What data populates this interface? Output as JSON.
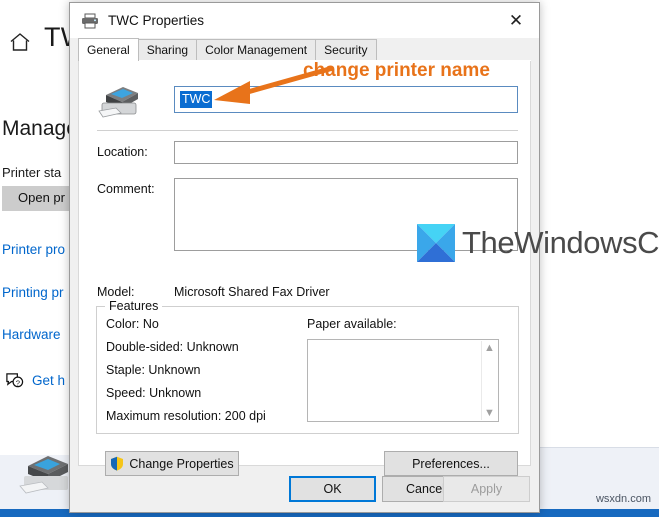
{
  "background": {
    "home_icon": "home-icon",
    "device_title": "TW",
    "manage_heading": "Manage",
    "printer_status_label": "Printer sta",
    "open_queue_button": "Open pr",
    "links": [
      "Printer pro",
      "Printing pr",
      "Hardware"
    ],
    "get_help_label": "Get h",
    "get_help_icon": "help-chat-icon",
    "printer_image": "printer-illustration-icon"
  },
  "watermarks": {
    "brand": "TheWindowsClub",
    "brand_logo": "thewindowsclub-logo-icon",
    "site": "wsxdn.com"
  },
  "dialog": {
    "title": "TWC Properties",
    "title_icon": "printer-icon",
    "close_label": "✕",
    "tabs": [
      {
        "label": "General",
        "active": true
      },
      {
        "label": "Sharing",
        "active": false
      },
      {
        "label": "Color Management",
        "active": false
      },
      {
        "label": "Security",
        "active": false
      }
    ],
    "printer_icon": "fax-printer-icon",
    "printer_name_value": "TWC",
    "fields": [
      {
        "label": "Location:",
        "value": ""
      },
      {
        "label": "Comment:",
        "value": ""
      }
    ],
    "model_label": "Model:",
    "model_value": "Microsoft Shared Fax Driver",
    "features": {
      "title": "Features",
      "items": [
        "Color: No",
        "Double-sided: Unknown",
        "Staple: Unknown",
        "Speed: Unknown",
        "Maximum resolution: 200 dpi"
      ],
      "paper_label": "Paper available:",
      "paper_items": [],
      "scroll_up_icon": "chevron-up-icon",
      "scroll_down_icon": "chevron-down-icon"
    },
    "buttons": {
      "change_properties": "Change Properties",
      "change_properties_icon": "uac-shield-icon",
      "preferences": "Preferences...",
      "ok": "OK",
      "cancel": "Cancel",
      "apply": "Apply"
    }
  },
  "annotation": {
    "text": "change printer name",
    "color": "#e8731a",
    "arrow_icon": "arrow-left-icon"
  }
}
